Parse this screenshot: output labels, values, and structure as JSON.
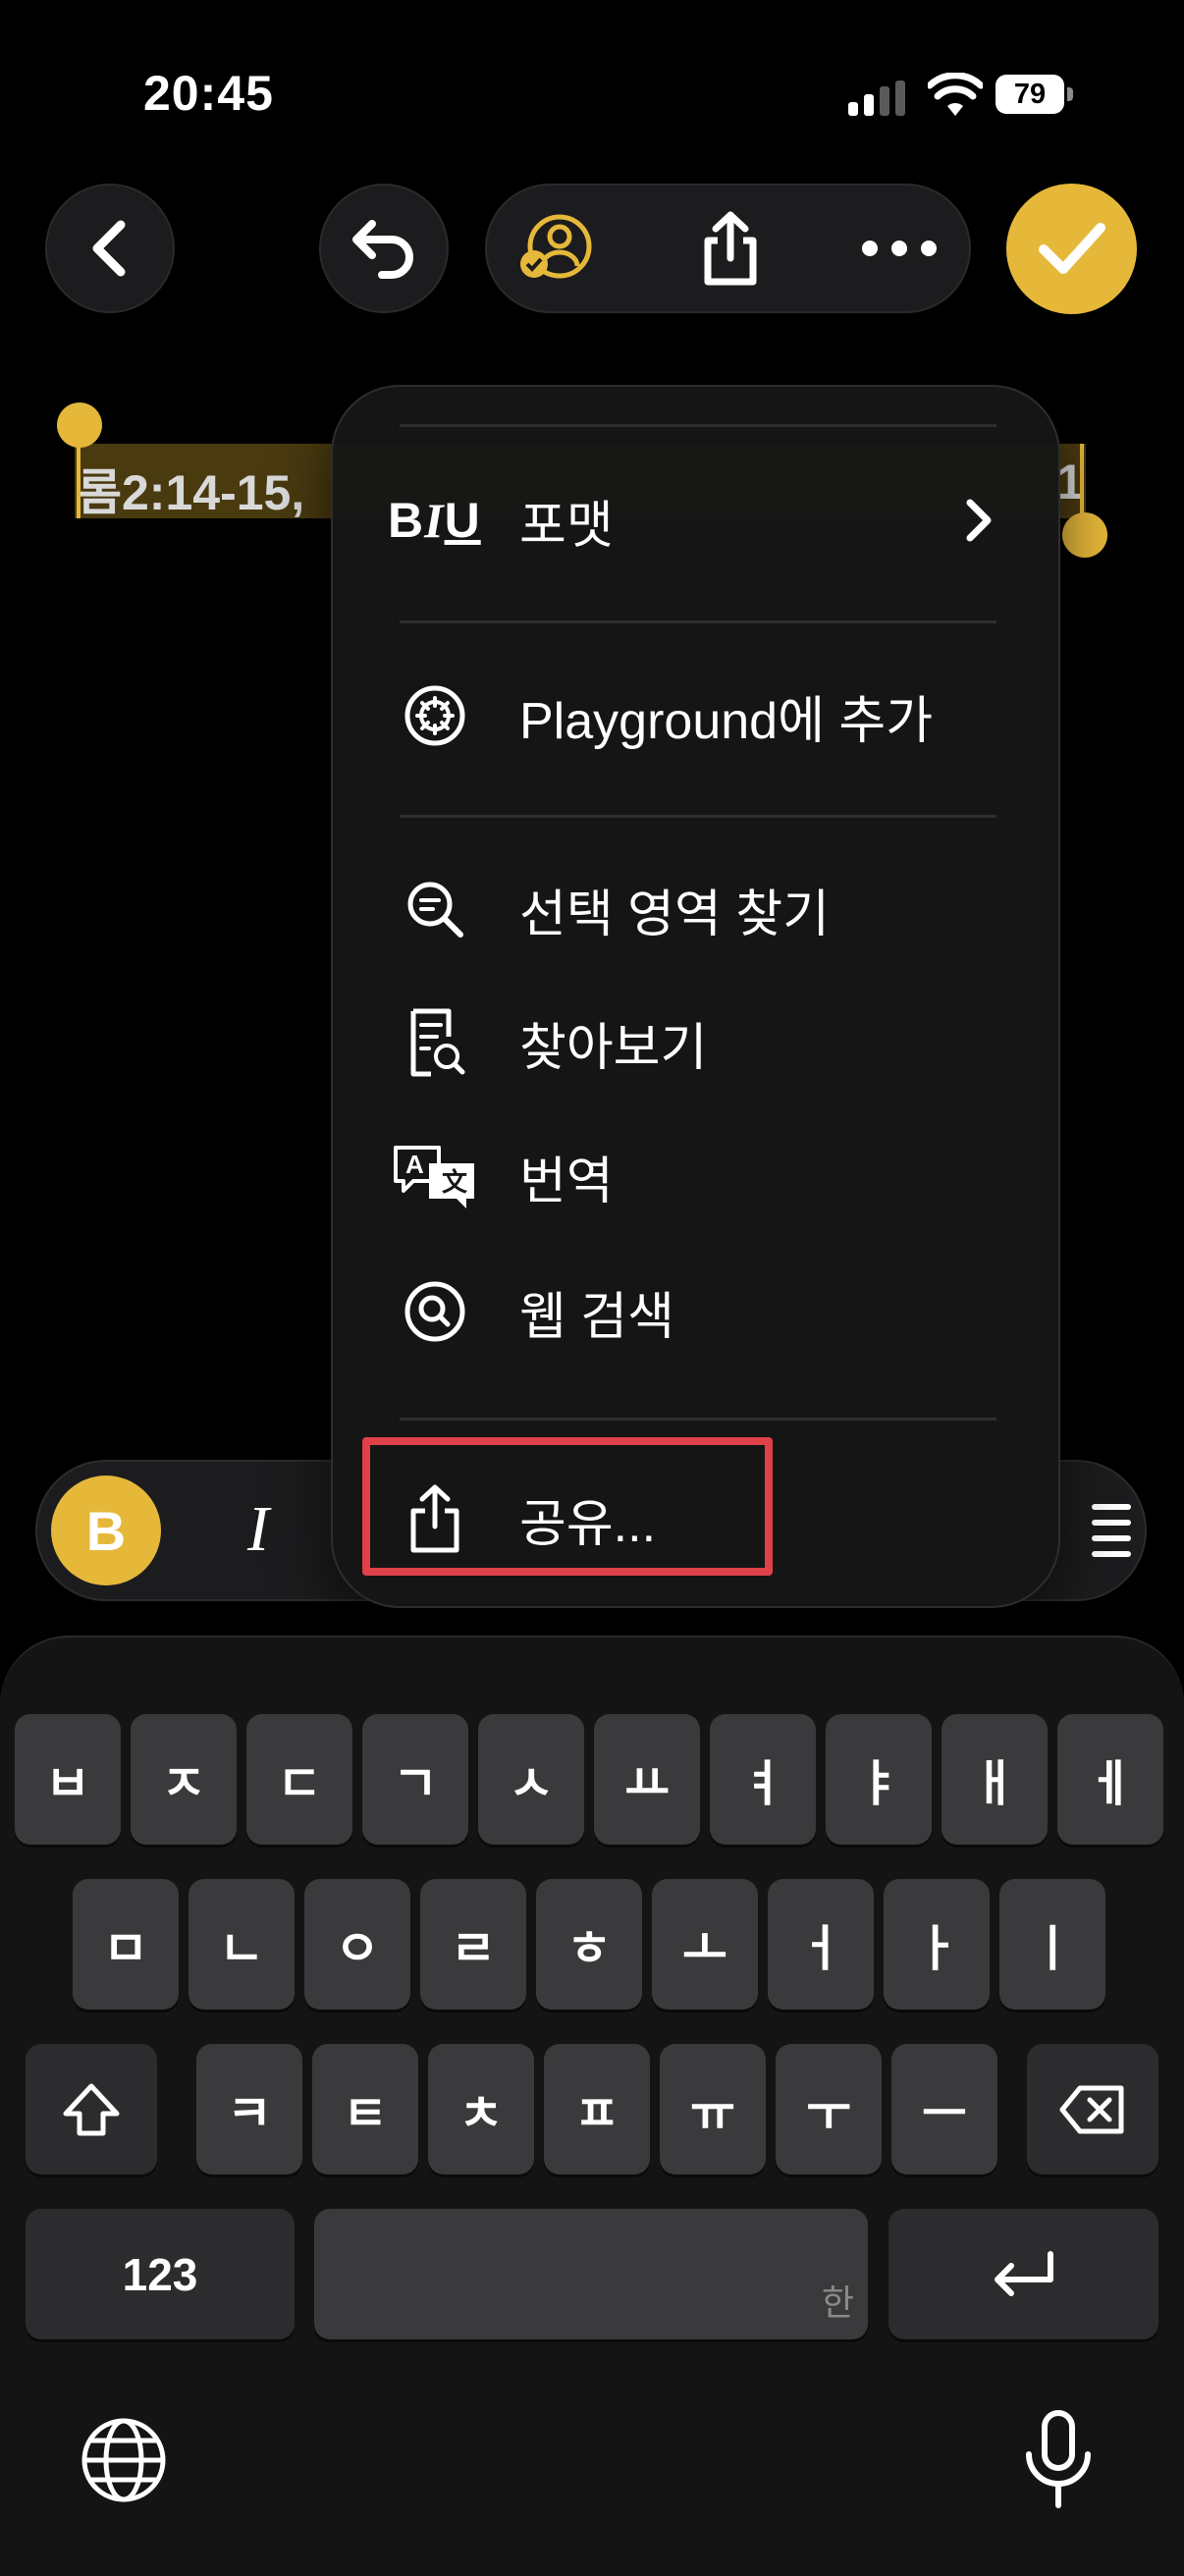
{
  "status_bar": {
    "time": "20:45",
    "battery": "79"
  },
  "editor": {
    "selected_text_start": "롬2:14-15,",
    "selected_text_end": "1"
  },
  "context_menu": {
    "format_label": "포맷",
    "biu_b": "B",
    "biu_i": "I",
    "biu_u": "U",
    "items": [
      {
        "label": "Playground에 추가",
        "icon": "playground-icon"
      },
      {
        "label": "선택 영역 찾기",
        "icon": "find-selection-icon"
      },
      {
        "label": "찾아보기",
        "icon": "lookup-icon"
      },
      {
        "label": "번역",
        "icon": "translate-icon"
      },
      {
        "label": "웹 검색",
        "icon": "web-search-icon"
      },
      {
        "label": "공유...",
        "icon": "share-icon"
      }
    ]
  },
  "format_bar": {
    "bold": "B",
    "italic": "I"
  },
  "keyboard": {
    "row1": [
      "ㅂ",
      "ㅈ",
      "ㄷ",
      "ㄱ",
      "ㅅ",
      "ㅛ",
      "ㅕ",
      "ㅑ",
      "ㅐ",
      "ㅔ"
    ],
    "row2": [
      "ㅁ",
      "ㄴ",
      "ㅇ",
      "ㄹ",
      "ㅎ",
      "ㅗ",
      "ㅓ",
      "ㅏ",
      "ㅣ"
    ],
    "row3": [
      "ㅋ",
      "ㅌ",
      "ㅊ",
      "ㅍ",
      "ㅠ",
      "ㅜ",
      "ㅡ"
    ],
    "numbers_key": "123",
    "space_hint": "한"
  },
  "colors": {
    "accent": "#e6b83a",
    "highlight_box": "#e0404a"
  }
}
